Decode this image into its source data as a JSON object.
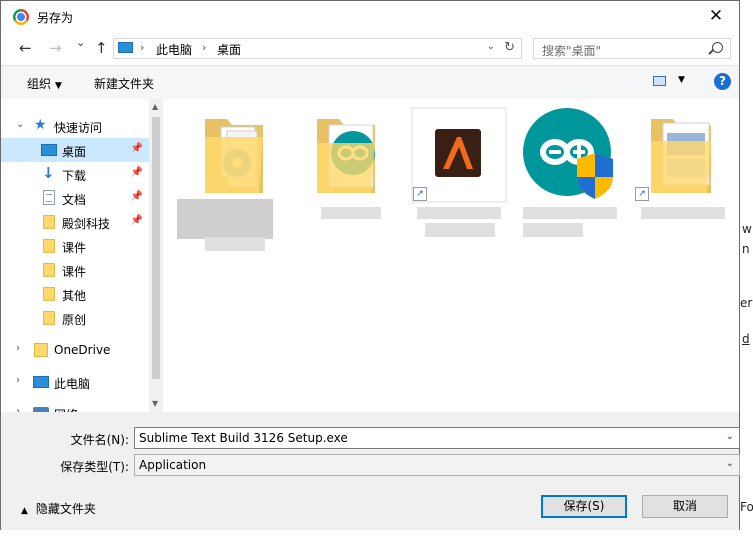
{
  "window": {
    "title": "另存为",
    "close": "✕"
  },
  "nav": {
    "back": "←",
    "forward": "→",
    "recent": "⌄",
    "up": "↑",
    "path": [
      "此电脑",
      "桌面"
    ],
    "separator": "›",
    "dropdown": "⌄",
    "refresh": "↻",
    "search_placeholder": "搜索\"桌面\""
  },
  "toolbar": {
    "organize": "组织",
    "new_folder": "新建文件夹",
    "help": "?"
  },
  "sidebar": {
    "quick_access": "快速访问",
    "items": [
      {
        "label": "桌面",
        "icon": "desktop-icon",
        "pinned": true,
        "selected": true
      },
      {
        "label": "下载",
        "icon": "download-icon",
        "pinned": true
      },
      {
        "label": "文档",
        "icon": "document-icon",
        "pinned": true
      },
      {
        "label": "殿剑科技",
        "icon": "folder-icon",
        "pinned": true
      },
      {
        "label": "课件",
        "icon": "folder-icon"
      },
      {
        "label": "课件",
        "icon": "folder-icon"
      },
      {
        "label": "其他",
        "icon": "folder-icon"
      },
      {
        "label": "原创",
        "icon": "folder-icon"
      }
    ],
    "onedrive": "OneDrive",
    "this_pc": "此电脑",
    "network": "网络",
    "pin_glyph": "📌"
  },
  "shortcut_glyph": "↗",
  "form": {
    "filename_label": "文件名(N):",
    "filename_value": "Sublime Text Build 3126 Setup.exe",
    "filetype_label": "保存类型(T):",
    "filetype_value": "Application",
    "caret": "⌄"
  },
  "footer": {
    "hide_folders": "隐藏文件夹",
    "save": "保存(S)",
    "cancel": "取消"
  },
  "background_fragments": [
    "w",
    "n",
    "er",
    "d",
    "Fo"
  ]
}
